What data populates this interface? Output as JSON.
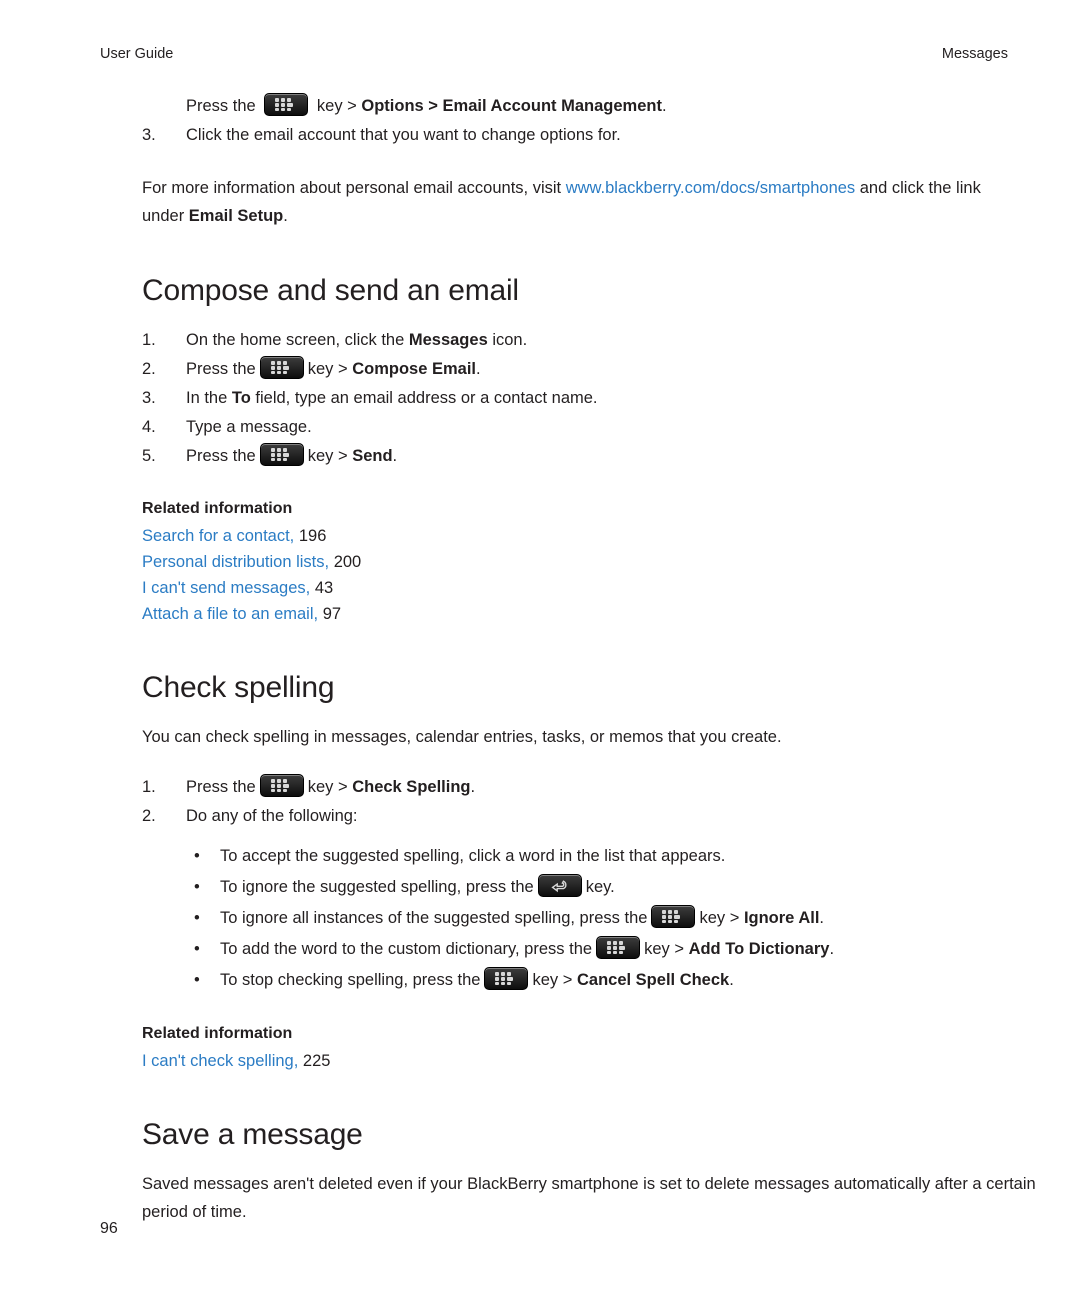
{
  "header": {
    "left": "User Guide",
    "right": "Messages"
  },
  "top_section": {
    "step_press": {
      "pre": "Press the",
      "mid": "key >",
      "bold": "Options > Email Account Management",
      "post": "."
    },
    "step3": {
      "num": "3.",
      "text": "Click the email account that you want to change options for."
    },
    "paragraph": {
      "pre": "For more information about personal email accounts, visit ",
      "link": "www.blackberry.com/docs/smartphones",
      "mid": " and click the link under ",
      "bold": "Email Setup",
      "post": "."
    }
  },
  "compose": {
    "title": "Compose and send an email",
    "steps": [
      {
        "num": "1.",
        "pre": "On the home screen, click the ",
        "bold": "Messages",
        "post": " icon."
      },
      {
        "num": "2.",
        "pre": "Press the",
        "mid": "key >",
        "bold": "Compose Email",
        "post": "."
      },
      {
        "num": "3.",
        "pre": "In the ",
        "bold": "To",
        "post": " field, type an email address or a contact name."
      },
      {
        "num": "4.",
        "pre": "Type a message.",
        "bold": "",
        "post": ""
      },
      {
        "num": "5.",
        "pre": "Press the",
        "mid": "key >",
        "bold": "Send",
        "post": "."
      }
    ],
    "related_heading": "Related information",
    "related": [
      {
        "label": "Search for a contact,",
        "page": "196"
      },
      {
        "label": "Personal distribution lists,",
        "page": "200"
      },
      {
        "label": "I can't send messages,",
        "page": "43"
      },
      {
        "label": "Attach a file to an email,",
        "page": "97"
      }
    ]
  },
  "spelling": {
    "title": "Check spelling",
    "intro": "You can check spelling in messages, calendar entries, tasks, or memos that you create.",
    "steps": [
      {
        "num": "1.",
        "pre": "Press the",
        "mid": "key >",
        "bold": "Check Spelling",
        "post": "."
      },
      {
        "num": "2.",
        "pre": "Do any of the following:",
        "bold": "",
        "post": ""
      }
    ],
    "bullets": [
      {
        "pre": "To accept the suggested spelling, click a word in the list that appears.",
        "key": "none",
        "mid": "",
        "bold": "",
        "post": ""
      },
      {
        "pre": "To ignore the suggested spelling, press the",
        "key": "escape",
        "mid": "key.",
        "bold": "",
        "post": ""
      },
      {
        "pre": "To ignore all instances of the suggested spelling, press the",
        "key": "menu",
        "mid": "key >",
        "bold": "Ignore All",
        "post": "."
      },
      {
        "pre": "To add the word to the custom dictionary, press the",
        "key": "menu",
        "mid": "key >",
        "bold": "Add To Dictionary",
        "post": "."
      },
      {
        "pre": "To stop checking spelling, press the",
        "key": "menu",
        "mid": "key >",
        "bold": "Cancel Spell Check",
        "post": "."
      }
    ],
    "related_heading": "Related information",
    "related": [
      {
        "label": "I can't check spelling,",
        "page": "225"
      }
    ]
  },
  "save": {
    "title": "Save a message",
    "paragraph": "Saved messages aren't deleted even if your BlackBerry smartphone is set to delete messages automatically after a certain period of time."
  },
  "footer": {
    "page_number": "96"
  }
}
